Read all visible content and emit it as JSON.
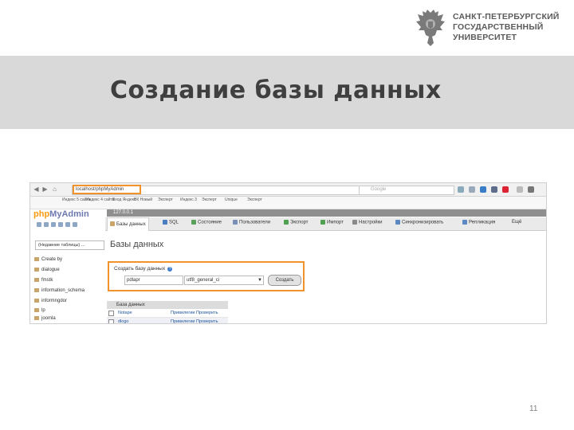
{
  "header": {
    "university_name": "САНКТ-ПЕТЕРБУРГСКИЙ\nГОСУДАРСТВЕННЫЙ\nУНИВЕРСИТЕТ",
    "logo_icon": "double-headed-eagle-icon"
  },
  "slide": {
    "title": "Создание базы данных",
    "page_number": "11"
  },
  "screenshot": {
    "browser": {
      "url": "localhost/phpMyAdmin",
      "search_placeholder": "Google",
      "bookmarks": [
        "Индекс 5 сайта",
        "Индекс 4 сайта",
        "Вход Яндекс",
        "ВК Новый",
        "Эксперт",
        "Индекс 3",
        "Эксперт",
        "Unique",
        "Эксперт"
      ]
    },
    "pma": {
      "logo_prefix": "php",
      "logo_brand": "MyAdmin",
      "table_filter": "(Недавние таблицы) ...",
      "sidebar_items": [
        "Create by",
        "dialogue",
        "fmstk",
        "information_schema",
        "informngdor",
        "lp",
        "joomla"
      ],
      "server_label": "127.0.0.1",
      "tabs": [
        "Базы данных",
        "SQL",
        "Состояние",
        "Пользователи",
        "Экспорт",
        "Импорт",
        "Настройки",
        "Синхронизировать",
        "Репликация",
        "Ещё"
      ],
      "page_heading": "Базы данных",
      "create_label": "Создать базу данных",
      "db_name_value": "pdlapr",
      "collation_value": "utf8_general_ci",
      "create_button": "Создать",
      "table_header": "База данных",
      "table_rows": [
        {
          "name": "Notape",
          "action": "Привилегии  Проверить"
        },
        {
          "name": "dlogo",
          "action": "Привилегии  Проверить"
        }
      ]
    }
  }
}
